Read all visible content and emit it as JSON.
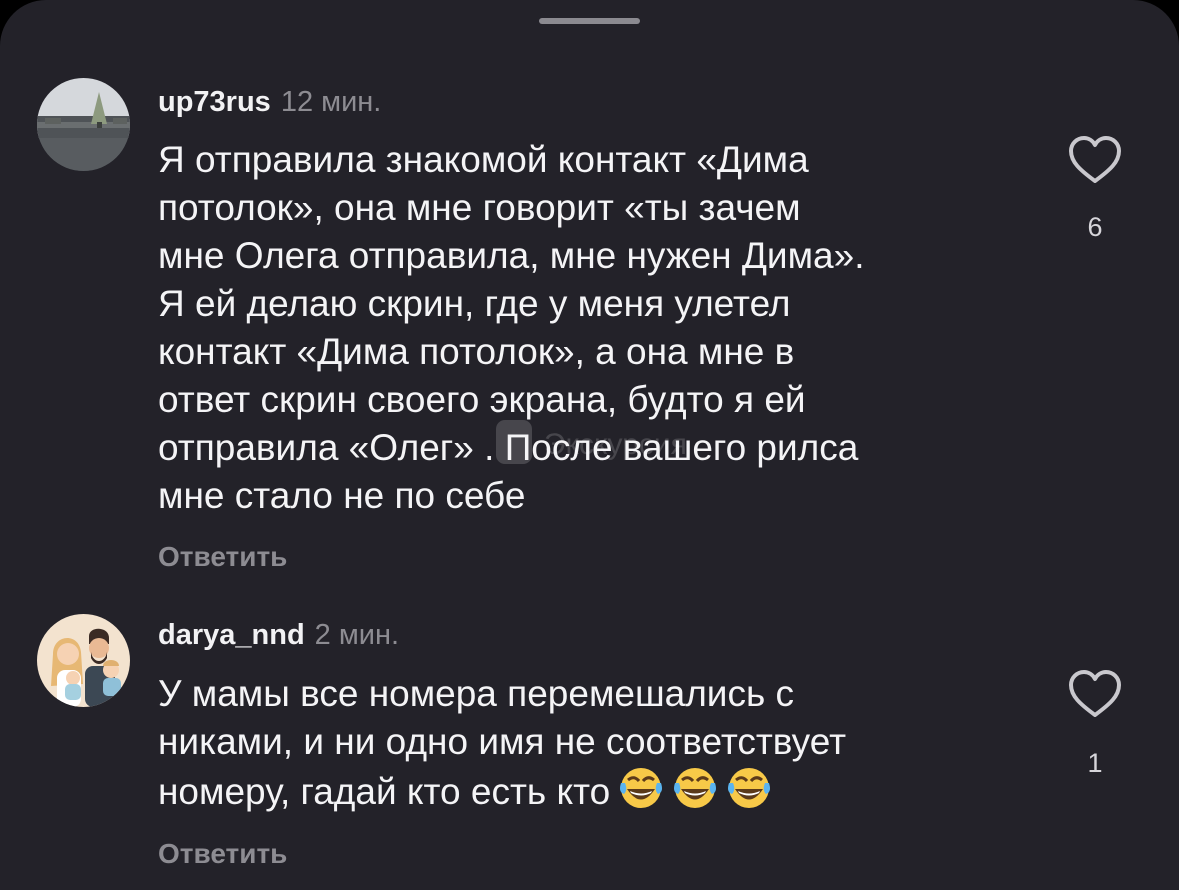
{
  "comments": [
    {
      "username": "up73rus",
      "time": "12 мин.",
      "text": "Я отправила знакомой контакт «Дима\nпотолок», она мне говорит «ты зачем\nмне Олега отправила, мне нужен Дима».\nЯ ей делаю скрин, где у меня улетел\nконтакт «Дима потолок», а она мне в\nответ скрин своего экрана, будто я ей\nотправила «Олег» . После вашего рилса\nмне стало не по себе",
      "reply_label": "Ответить",
      "likes": "6",
      "like_icon": "heart-outline-icon"
    },
    {
      "username": "darya_nnd",
      "time": "2 мин.",
      "text": "У мамы все номера перемешались с\nниками, и ни одно имя не соответствует\nномеру, гадай кто есть кто",
      "emojis": [
        "face-with-tears-of-joy",
        "face-with-tears-of-joy",
        "face-with-tears-of-joy"
      ],
      "reply_label": "Ответить",
      "likes": "1",
      "like_icon": "heart-outline-icon"
    }
  ],
  "colors": {
    "background": "#232229",
    "primary_text": "#f4f4f6",
    "secondary_text": "#8d8c92"
  }
}
